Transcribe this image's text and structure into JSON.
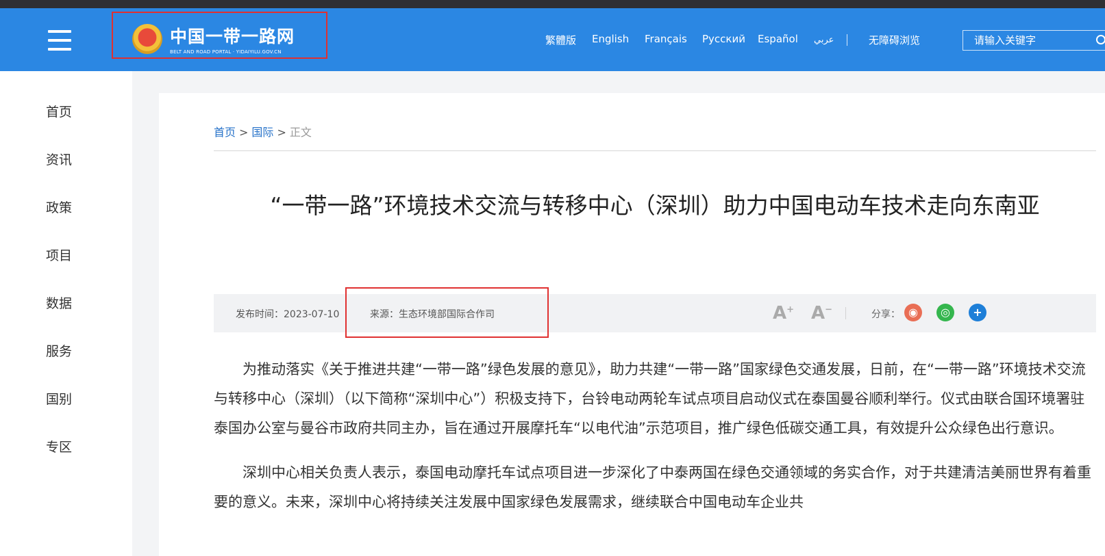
{
  "bookmarks": [],
  "header": {
    "logo": {
      "cn": "中国一带一路网",
      "en": "BELT AND ROAD PORTAL · YIDAIYILU.GOV.CN"
    },
    "languages": [
      "繁體版",
      "English",
      "Français",
      "Русский",
      "Español",
      "عربي"
    ],
    "accessibility": "无障碍浏览",
    "search": {
      "placeholder": "请输入关键字"
    }
  },
  "sidebar": {
    "items": [
      {
        "label": "首页"
      },
      {
        "label": "资讯"
      },
      {
        "label": "政策"
      },
      {
        "label": "项目"
      },
      {
        "label": "数据"
      },
      {
        "label": "服务"
      },
      {
        "label": "国别"
      },
      {
        "label": "专区"
      }
    ]
  },
  "breadcrumb": {
    "home": "首页",
    "section": "国际",
    "current": "正文",
    "separator": ">"
  },
  "article": {
    "title": "“一带一路”环境技术交流与转移中心（深圳）助力中国电动车技术走向东南亚",
    "publish_time": "发布时间：2023-07-10",
    "source": "来源：生态环境部国际合作司",
    "font_up": "A",
    "font_down": "A",
    "share_label": "分享：",
    "paragraphs": [
      "为推动落实《关于推进共建“一带一路”绿色发展的意见》，助力共建“一带一路”国家绿色交通发展，日前，在“一带一路”环境技术交流与转移中心（深圳）（以下简称“深圳中心”）积极支持下，台铃电动两轮车试点项目启动仪式在泰国曼谷顺利举行。仪式由联合国环境署驻泰国办公室与曼谷市政府共同主办，旨在通过开展摩托车“以电代油”示范项目，推广绿色低碳交通工具，有效提升公众绿色出行意识。",
      "深圳中心相关负责人表示，泰国电动摩托车试点项目进一步深化了中泰两国在绿色交通领域的务实合作，对于共建清洁美丽世界有着重要的意义。未来，深圳中心将持续关注发展中国家绿色发展需求，继续联合中国电动车企业共"
    ]
  },
  "colors": {
    "header_bg": "#2b87e3",
    "link": "#2672c9",
    "highlight_border": "#e03030"
  }
}
